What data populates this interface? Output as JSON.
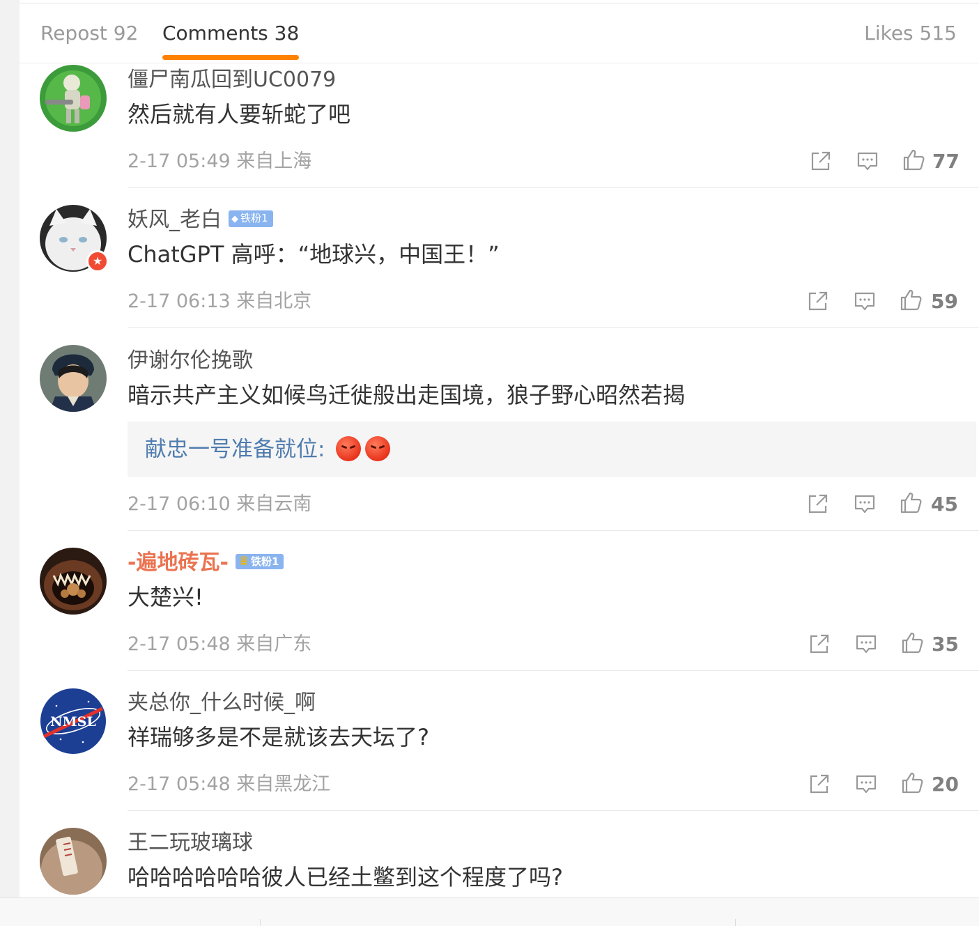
{
  "tabs": {
    "repost": "Repost 92",
    "comments": "Comments 38",
    "likes": "Likes 515"
  },
  "comments": [
    {
      "username": "僵尸南瓜回到UC0079",
      "text": "然后就有人要斩蛇了吧",
      "time": "2-17 05:49",
      "location": "来自上海",
      "likes": "77"
    },
    {
      "username": "妖风_老白",
      "badge": "铁粉1",
      "text": "ChatGPT 高呼：“地球兴，中国王！”",
      "time": "2-17 06:13",
      "location": "来自北京",
      "likes": "59"
    },
    {
      "username": "伊谢尔伦挽歌",
      "text": "暗示共产主义如候鸟迁徙般出走国境，狼子野心昭然若揭",
      "reply": {
        "user": "献忠一号准备就位",
        "sep": ":"
      },
      "time": "2-17 06:10",
      "location": "来自云南",
      "likes": "45"
    },
    {
      "username": "-遍地砖瓦-",
      "badge": "铁粉1",
      "text": "大楚兴!",
      "time": "2-17 05:48",
      "location": "来自广东",
      "likes": "35"
    },
    {
      "username": "夹总你_什么时候_啊",
      "text": "祥瑞够多是不是就该去天坛了?",
      "avatar_text": "NMSL",
      "time": "2-17 05:48",
      "location": "来自黑龙江",
      "likes": "20"
    },
    {
      "username": "王二玩玻璃球",
      "text": "哈哈哈哈哈哈彼人已经土鳖到这个程度了吗?"
    }
  ],
  "colors": {
    "accent": "#ff8200",
    "reply_user": "#4f7cae",
    "orange_name": "#eb7350",
    "fan_badge": "#89b4ef"
  },
  "icons": [
    "share-icon",
    "comment-icon",
    "thumbs-up-icon",
    "vip-star-icon",
    "diamond-icon",
    "crown-icon",
    "angry-emoji-icon"
  ]
}
